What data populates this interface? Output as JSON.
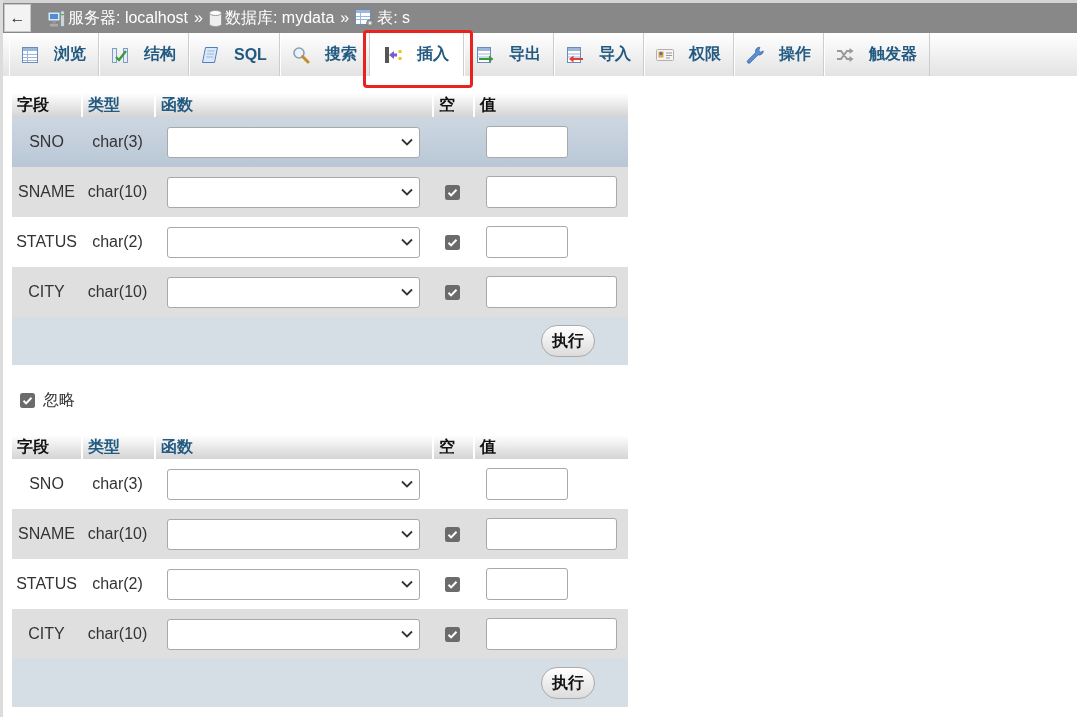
{
  "breadcrumb": {
    "back_button": "←",
    "items": [
      {
        "kind": "server",
        "label": "服务器: localhost",
        "separator": "»"
      },
      {
        "kind": "database",
        "label": "数据库: mydata",
        "separator": "»"
      },
      {
        "kind": "table",
        "label": "表: s"
      }
    ]
  },
  "tabs": [
    {
      "kind": "browse",
      "label": "浏览",
      "selected": false,
      "annotated": false
    },
    {
      "kind": "structure",
      "label": "结构",
      "selected": false,
      "annotated": false
    },
    {
      "kind": "sql",
      "label": "SQL",
      "selected": false,
      "annotated": false
    },
    {
      "kind": "search",
      "label": "搜索",
      "selected": false,
      "annotated": false
    },
    {
      "kind": "insert",
      "label": "插入",
      "selected": true,
      "annotated": true
    },
    {
      "kind": "export",
      "label": "导出",
      "selected": false,
      "annotated": false
    },
    {
      "kind": "import",
      "label": "导入",
      "selected": false,
      "annotated": false
    },
    {
      "kind": "privileges",
      "label": "权限",
      "selected": false,
      "annotated": false
    },
    {
      "kind": "operations",
      "label": "操作",
      "selected": false,
      "annotated": false
    },
    {
      "kind": "triggers",
      "label": "触发器",
      "selected": false,
      "annotated": false
    }
  ],
  "sections": [
    {
      "kind": "form",
      "columns": [
        {
          "label": "字段",
          "link": false
        },
        {
          "label": "类型",
          "link": true
        },
        {
          "label": "函数",
          "link": true
        },
        {
          "label": "空",
          "link": false
        },
        {
          "label": "值",
          "link": false
        }
      ],
      "rows": [
        {
          "field": "SNO",
          "type": "char(3)",
          "highlighted": true,
          "nullable": false
        },
        {
          "field": "SNAME",
          "type": "char(10)",
          "highlighted": false,
          "nullable": true,
          "null_checked": true
        },
        {
          "field": "STATUS",
          "type": "char(2)",
          "highlighted": false,
          "nullable": true,
          "null_checked": true
        },
        {
          "field": "CITY",
          "type": "char(10)",
          "highlighted": false,
          "nullable": true,
          "null_checked": true
        }
      ],
      "submit": "执行"
    },
    {
      "kind": "option",
      "label": "忽略",
      "checked": true
    },
    {
      "kind": "form",
      "columns": [
        {
          "label": "字段",
          "link": false
        },
        {
          "label": "类型",
          "link": true
        },
        {
          "label": "函数",
          "link": true
        },
        {
          "label": "空",
          "link": false
        },
        {
          "label": "值",
          "link": false
        }
      ],
      "rows": [
        {
          "field": "SNO",
          "type": "char(3)",
          "highlighted": false,
          "nullable": false
        },
        {
          "field": "SNAME",
          "type": "char(10)",
          "highlighted": false,
          "nullable": true,
          "null_checked": true
        },
        {
          "field": "STATUS",
          "type": "char(2)",
          "highlighted": false,
          "nullable": true,
          "null_checked": true
        },
        {
          "field": "CITY",
          "type": "char(10)",
          "highlighted": false,
          "nullable": true,
          "null_checked": true
        }
      ],
      "submit": "执行"
    }
  ]
}
